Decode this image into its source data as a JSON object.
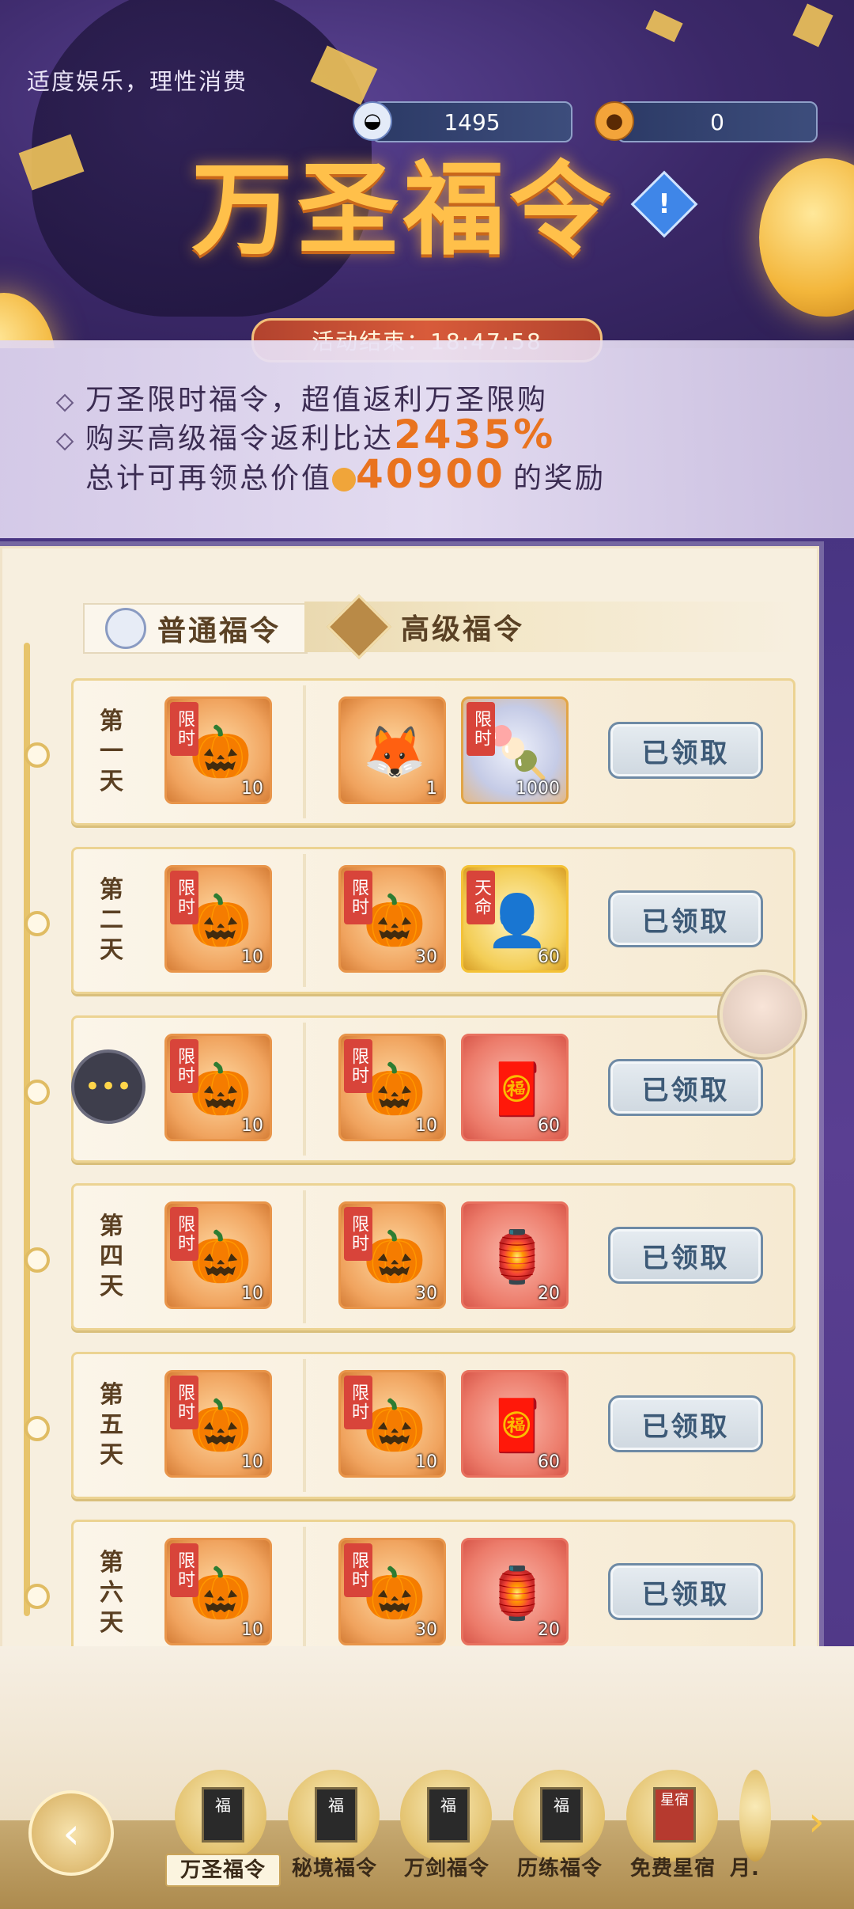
{
  "notice": "适度娱乐，理性消费",
  "currencies": [
    {
      "icon": "blue-bowl-icon",
      "value": "1495"
    },
    {
      "icon": "pumpkin-coin-icon",
      "value": "0"
    }
  ],
  "title": "万圣福令",
  "timer_label": "活动结束：18:47:58",
  "description": {
    "line1": "万圣限时福令，超值返利万圣限购",
    "line2_prefix": "购买高级福令返利比达",
    "line2_value": "2435%",
    "line3_prefix": "总计可再领总价值",
    "line3_value": "40900",
    "line3_suffix": "的奖励"
  },
  "tabs": {
    "normal": "普通福令",
    "premium": "高级福令"
  },
  "rows": [
    {
      "day": [
        "第",
        "一",
        "天"
      ],
      "items": [
        {
          "tag": "限时",
          "qty": "10"
        },
        {
          "tag": "",
          "qty": "1"
        },
        {
          "tag": "限时",
          "qty": "1000"
        }
      ],
      "claim": "已领取"
    },
    {
      "day": [
        "第",
        "二",
        "天"
      ],
      "items": [
        {
          "tag": "限时",
          "qty": "10"
        },
        {
          "tag": "限时",
          "qty": "30"
        },
        {
          "tag": "天命",
          "qty": "60"
        }
      ],
      "claim": "已领取"
    },
    {
      "day": [
        "",
        "",
        "天"
      ],
      "items": [
        {
          "tag": "限时",
          "qty": "10"
        },
        {
          "tag": "限时",
          "qty": "10"
        },
        {
          "tag": "",
          "qty": "60"
        }
      ],
      "claim": "已领取"
    },
    {
      "day": [
        "第",
        "四",
        "天"
      ],
      "items": [
        {
          "tag": "限时",
          "qty": "10"
        },
        {
          "tag": "限时",
          "qty": "30"
        },
        {
          "tag": "",
          "qty": "20"
        }
      ],
      "claim": "已领取"
    },
    {
      "day": [
        "第",
        "五",
        "天"
      ],
      "items": [
        {
          "tag": "限时",
          "qty": "10"
        },
        {
          "tag": "限时",
          "qty": "10"
        },
        {
          "tag": "",
          "qty": "60"
        }
      ],
      "claim": "已领取"
    },
    {
      "day": [
        "第",
        "六",
        "天"
      ],
      "items": [
        {
          "tag": "限时",
          "qty": "10"
        },
        {
          "tag": "限时",
          "qty": "30"
        },
        {
          "tag": "",
          "qty": "20"
        }
      ],
      "claim": "已领取"
    }
  ],
  "bottom_nav": [
    {
      "label": "万圣福令",
      "book": "福",
      "active": true
    },
    {
      "label": "秘境福令",
      "book": "福",
      "active": false
    },
    {
      "label": "万剑福令",
      "book": "福",
      "active": false
    },
    {
      "label": "历练福令",
      "book": "福",
      "active": false
    },
    {
      "label": "免费星宿",
      "book": "星宿",
      "active": false
    },
    {
      "label": "月.",
      "book": "",
      "active": false
    }
  ],
  "colors": {
    "accent": "#e9731f",
    "timer_bg": "#d85b3a",
    "claim_text": "#3d5a77"
  }
}
